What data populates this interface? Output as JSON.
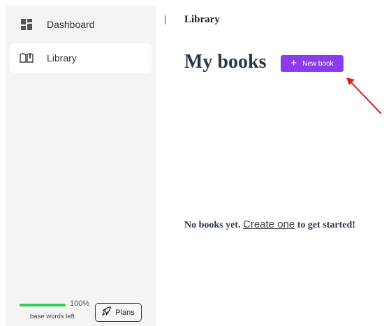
{
  "sidebar": {
    "items": [
      {
        "label": "Dashboard",
        "icon": "dashboard-grid-icon",
        "active": false
      },
      {
        "label": "Library",
        "icon": "open-book-icon",
        "active": true
      }
    ],
    "usage": {
      "percent_label": "100%",
      "progress_fraction": 1.0,
      "words_left_label": "base words left"
    },
    "plans_button": {
      "label": "Plans",
      "icon": "rocket-icon"
    }
  },
  "header": {
    "breadcrumb": "Library"
  },
  "main": {
    "title": "My books",
    "new_book_button": {
      "label": "New book",
      "icon": "plus-icon"
    },
    "empty_state": {
      "prefix": "No books yet.",
      "link": "Create one",
      "suffix": "to get started!"
    }
  },
  "colors": {
    "accent": "#8b3cf0",
    "progress": "#33cc55",
    "annotation_arrow": "#e02020",
    "sidebar_bg": "#f4f4f4"
  }
}
